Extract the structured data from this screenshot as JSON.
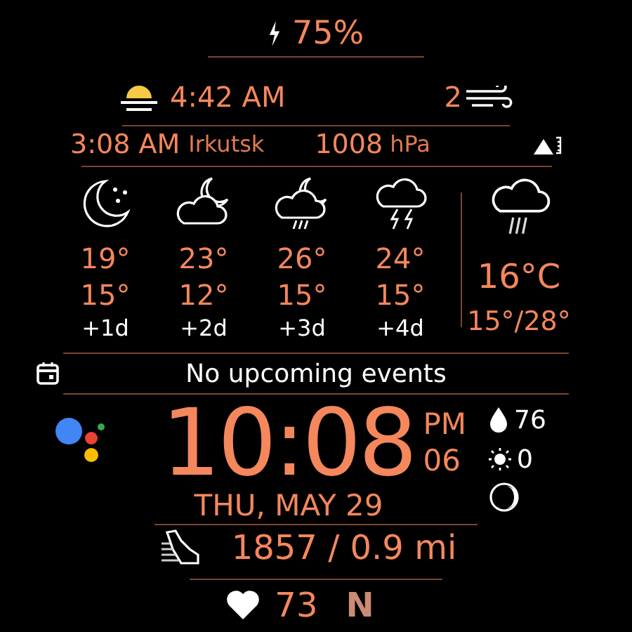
{
  "battery": {
    "text": "75%"
  },
  "sun": {
    "time": "4:42 AM"
  },
  "wind": {
    "speed": "2"
  },
  "world_clock": {
    "time": "3:08 AM",
    "city": "Irkutsk"
  },
  "pressure": {
    "value": "1008",
    "unit": "hPa"
  },
  "forecast": [
    {
      "kind": "clear-night",
      "high": "19°",
      "low": "15°",
      "day": "+1d"
    },
    {
      "kind": "cloudy-night",
      "high": "23°",
      "low": "12°",
      "day": "+2d"
    },
    {
      "kind": "rain-night",
      "high": "26°",
      "low": "15°",
      "day": "+3d"
    },
    {
      "kind": "thunder",
      "high": "24°",
      "low": "15°",
      "day": "+4d"
    }
  ],
  "current_weather": {
    "kind": "rain",
    "temp": "16°C",
    "range": "15°/28°"
  },
  "events": {
    "text": "No upcoming events"
  },
  "clock": {
    "time": "10:08",
    "ampm": "PM",
    "seconds": "06",
    "date": "THU, MAY 29"
  },
  "stats": {
    "humidity": "76",
    "uv": "0"
  },
  "steps": {
    "text": "1857 / 0.9 mi"
  },
  "heart_rate": {
    "value": "73"
  },
  "notification": {
    "letter": "N"
  }
}
